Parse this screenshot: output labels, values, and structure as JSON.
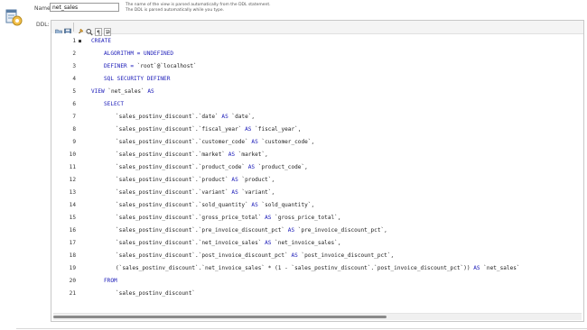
{
  "form": {
    "name_label": "Name:",
    "name_value": "net_sales",
    "name_hint": "The name of the view is parsed automatically from the DDL statement. The DDL is parsed automatically while you type.",
    "ddl_label": "DDL:"
  },
  "toolbar": {
    "icons": [
      "open-file-icon",
      "save-file-icon",
      "beautify-icon",
      "find-icon",
      "toggle-whitespace-icon",
      "word-wrap-icon"
    ]
  },
  "editor": {
    "lines": [
      {
        "n": "1",
        "fold": "■",
        "indent": 0,
        "tokens": [
          {
            "t": "CREATE",
            "c": "kw"
          }
        ]
      },
      {
        "n": "2",
        "fold": "",
        "indent": 1,
        "tokens": [
          {
            "t": "ALGORITHM = UNDEFINED",
            "c": "kw"
          }
        ]
      },
      {
        "n": "3",
        "fold": "",
        "indent": 1,
        "tokens": [
          {
            "t": "DEFINER = ",
            "c": "kw"
          },
          {
            "t": "`root`@`localhost`",
            "c": "id"
          }
        ]
      },
      {
        "n": "4",
        "fold": "",
        "indent": 1,
        "tokens": [
          {
            "t": "SQL SECURITY DEFINER",
            "c": "kw"
          }
        ]
      },
      {
        "n": "5",
        "fold": "",
        "indent": 0,
        "tokens": [
          {
            "t": "VIEW ",
            "c": "kw"
          },
          {
            "t": "`net_sales`",
            "c": "id"
          },
          {
            "t": " AS",
            "c": "kw"
          }
        ]
      },
      {
        "n": "6",
        "fold": "",
        "indent": 1,
        "tokens": [
          {
            "t": "SELECT",
            "c": "kw"
          }
        ]
      },
      {
        "n": "7",
        "fold": "",
        "indent": 2,
        "tokens": [
          {
            "t": "`sales_postinv_discount`.`date`",
            "c": "id"
          },
          {
            "t": " AS ",
            "c": "kw"
          },
          {
            "t": "`date`,",
            "c": "id"
          }
        ]
      },
      {
        "n": "8",
        "fold": "",
        "indent": 2,
        "tokens": [
          {
            "t": "`sales_postinv_discount`.`fiscal_year`",
            "c": "id"
          },
          {
            "t": " AS ",
            "c": "kw"
          },
          {
            "t": "`fiscal_year`,",
            "c": "id"
          }
        ]
      },
      {
        "n": "9",
        "fold": "",
        "indent": 2,
        "tokens": [
          {
            "t": "`sales_postinv_discount`.`customer_code`",
            "c": "id"
          },
          {
            "t": " AS ",
            "c": "kw"
          },
          {
            "t": "`customer_code`,",
            "c": "id"
          }
        ]
      },
      {
        "n": "10",
        "fold": "",
        "indent": 2,
        "tokens": [
          {
            "t": "`sales_postinv_discount`.`market`",
            "c": "id"
          },
          {
            "t": " AS ",
            "c": "kw"
          },
          {
            "t": "`market`,",
            "c": "id"
          }
        ]
      },
      {
        "n": "11",
        "fold": "",
        "indent": 2,
        "tokens": [
          {
            "t": "`sales_postinv_discount`.`product_code`",
            "c": "id"
          },
          {
            "t": " AS ",
            "c": "kw"
          },
          {
            "t": "`product_code`,",
            "c": "id"
          }
        ]
      },
      {
        "n": "12",
        "fold": "",
        "indent": 2,
        "tokens": [
          {
            "t": "`sales_postinv_discount`.`product`",
            "c": "id"
          },
          {
            "t": " AS ",
            "c": "kw"
          },
          {
            "t": "`product`,",
            "c": "id"
          }
        ]
      },
      {
        "n": "13",
        "fold": "",
        "indent": 2,
        "tokens": [
          {
            "t": "`sales_postinv_discount`.`variant`",
            "c": "id"
          },
          {
            "t": " AS ",
            "c": "kw"
          },
          {
            "t": "`variant`,",
            "c": "id"
          }
        ]
      },
      {
        "n": "14",
        "fold": "",
        "indent": 2,
        "tokens": [
          {
            "t": "`sales_postinv_discount`.`sold_quantity`",
            "c": "id"
          },
          {
            "t": " AS ",
            "c": "kw"
          },
          {
            "t": "`sold_quantity`,",
            "c": "id"
          }
        ]
      },
      {
        "n": "15",
        "fold": "",
        "indent": 2,
        "tokens": [
          {
            "t": "`sales_postinv_discount`.`gross_price_total`",
            "c": "id"
          },
          {
            "t": " AS ",
            "c": "kw"
          },
          {
            "t": "`gross_price_total`,",
            "c": "id"
          }
        ]
      },
      {
        "n": "16",
        "fold": "",
        "indent": 2,
        "tokens": [
          {
            "t": "`sales_postinv_discount`.`pre_invoice_discount_pct`",
            "c": "id"
          },
          {
            "t": " AS ",
            "c": "kw"
          },
          {
            "t": "`pre_invoice_discount_pct`,",
            "c": "id"
          }
        ]
      },
      {
        "n": "17",
        "fold": "",
        "indent": 2,
        "tokens": [
          {
            "t": "`sales_postinv_discount`.`net_invoice_sales`",
            "c": "id"
          },
          {
            "t": " AS ",
            "c": "kw"
          },
          {
            "t": "`net_invoice_sales`,",
            "c": "id"
          }
        ]
      },
      {
        "n": "18",
        "fold": "",
        "indent": 2,
        "tokens": [
          {
            "t": "`sales_postinv_discount`.`post_invoice_discount_pct`",
            "c": "id"
          },
          {
            "t": " AS ",
            "c": "kw"
          },
          {
            "t": "`post_invoice_discount_pct`,",
            "c": "id"
          }
        ]
      },
      {
        "n": "19",
        "fold": "",
        "indent": 2,
        "tokens": [
          {
            "t": "(`sales_postinv_discount`.`net_invoice_sales` * (1 - `sales_postinv_discount`.`post_invoice_discount_pct`))",
            "c": "id"
          },
          {
            "t": " AS ",
            "c": "kw"
          },
          {
            "t": "`net_sales`",
            "c": "id"
          }
        ]
      },
      {
        "n": "20",
        "fold": "",
        "indent": 1,
        "tokens": [
          {
            "t": "FROM",
            "c": "kw"
          }
        ]
      },
      {
        "n": "21",
        "fold": "",
        "indent": 2,
        "tokens": [
          {
            "t": "`sales_postinv_discount`",
            "c": "id"
          }
        ]
      }
    ]
  },
  "scrollbar": {
    "thumb_fraction": 0.63
  }
}
